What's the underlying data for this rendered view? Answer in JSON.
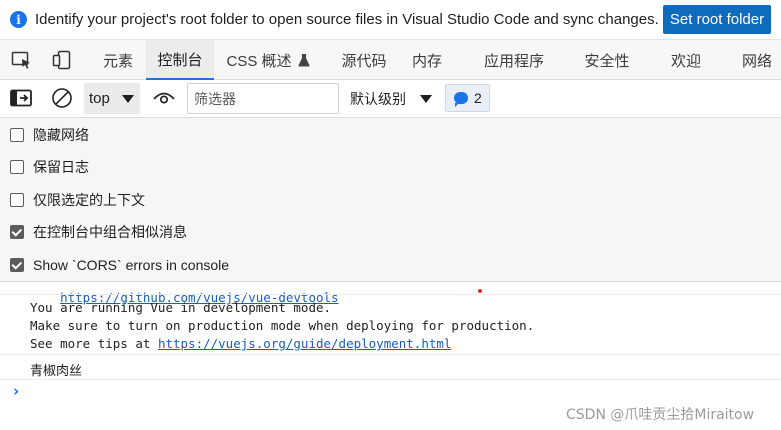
{
  "infobar": {
    "icon": "info-icon",
    "icon_glyph": "i",
    "message": "Identify your project's root folder to open source files in Visual Studio Code and sync changes.",
    "button_label": "Set root folder"
  },
  "tabbar": {
    "left_icons": [
      "inspect-element-icon",
      "device-emulation-icon"
    ],
    "tabs": [
      {
        "label": "元素",
        "active": false
      },
      {
        "label": "控制台",
        "active": true
      },
      {
        "label": "CSS 概述",
        "active": false,
        "icon": "flask-icon"
      },
      {
        "label": "源代码",
        "active": false
      },
      {
        "label": "内存",
        "active": false
      },
      {
        "label": "应用程序",
        "active": false
      },
      {
        "label": "安全性",
        "active": false
      },
      {
        "label": "欢迎",
        "active": false
      },
      {
        "label": "网络",
        "active": false
      }
    ]
  },
  "toolbar": {
    "sidebar_icon": "sidebar-toggle-icon",
    "clear_icon": "clear-console-icon",
    "context_value": "top",
    "eye_icon": "live-expression-eye-icon",
    "filter_placeholder": "筛选器",
    "level_label": "默认级别",
    "message_count": "2"
  },
  "settings": [
    {
      "label": "隐藏网络",
      "checked": false
    },
    {
      "label": "保留日志",
      "checked": false
    },
    {
      "label": "仅限选定的上下文",
      "checked": false
    },
    {
      "label": "在控制台中组合相似消息",
      "checked": true
    },
    {
      "label": "Show `CORS` errors in console",
      "checked": true
    }
  ],
  "console": {
    "cut_link": "https://github.com/vuejs/vue-devtools",
    "lines": [
      "You are running Vue in development mode.",
      "Make sure to turn on production mode when deploying for production.",
      "See more tips at "
    ],
    "tips_link": "https://vuejs.org/guide/deployment.html",
    "log_text": "青椒肉丝",
    "prompt": "›"
  },
  "watermark": "CSDN @爪哇贡尘拾Miraitow"
}
